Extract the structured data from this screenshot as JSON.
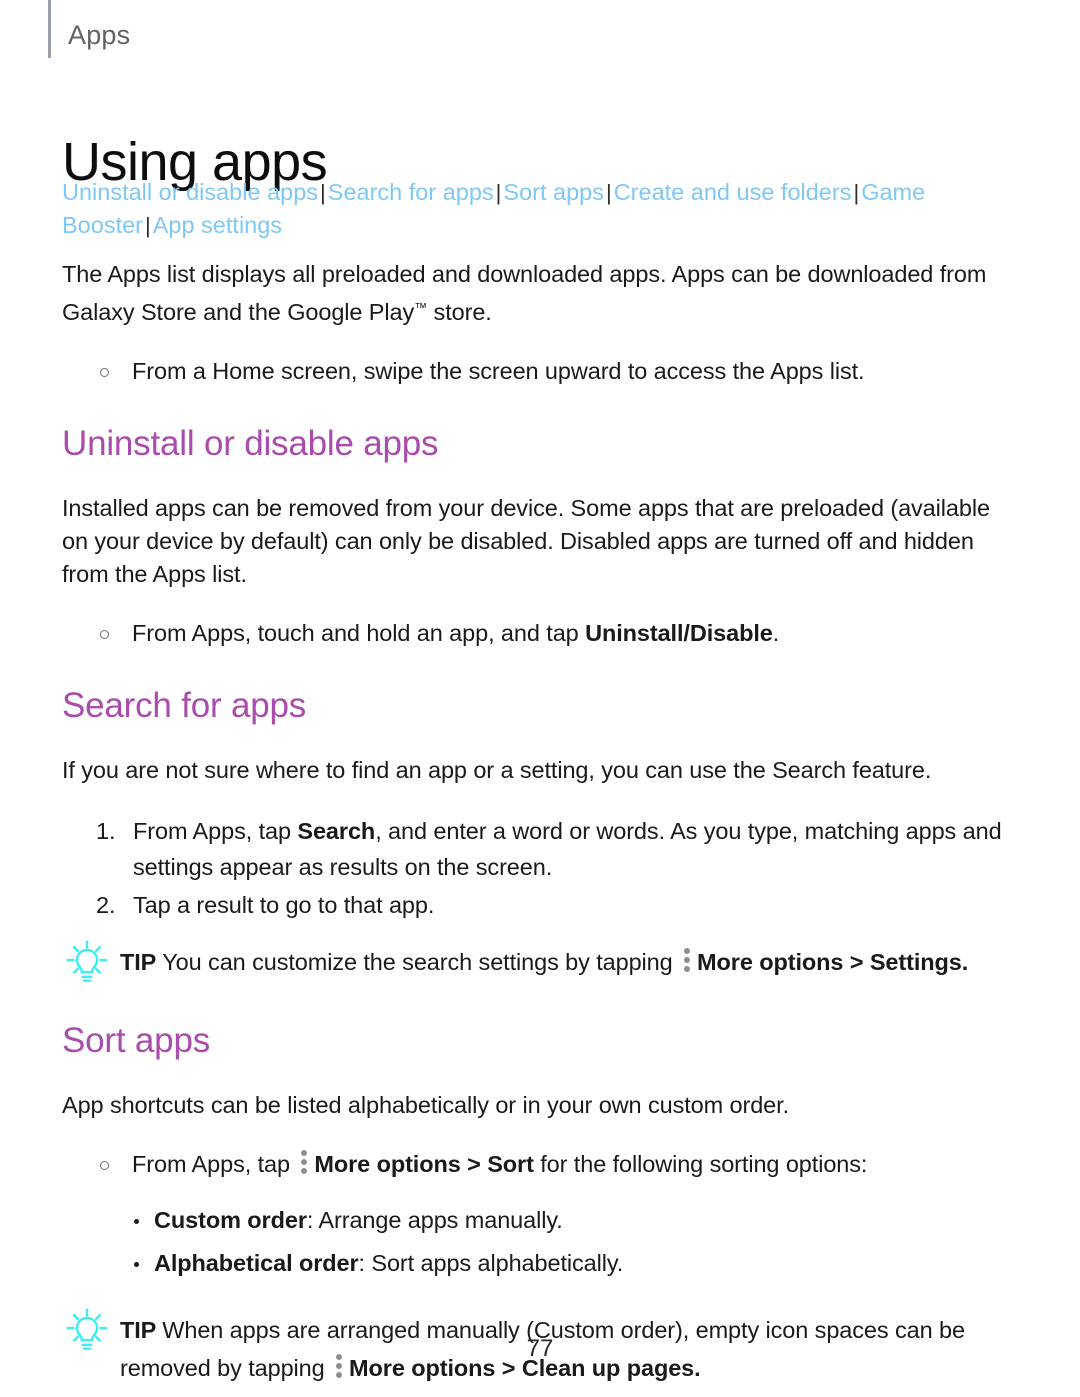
{
  "document": {
    "running_header": "Apps",
    "chapter_title": "Using apps",
    "page_number": "77"
  },
  "colors": {
    "link": "#7ec8f5",
    "section_heading": "#a94cab",
    "tip_icon": "#3deef0",
    "body_text": "#1a1a1a",
    "running_header_text": "#5f6368",
    "kebab_dots": "#8e8e8e"
  },
  "linkbar": {
    "separator": "|",
    "links": [
      {
        "label": "Uninstall or disable apps"
      },
      {
        "label": "Search for apps"
      },
      {
        "label": "Sort apps"
      },
      {
        "label": "Create and use folders"
      },
      {
        "label": "Game Booster"
      },
      {
        "label": "App settings"
      }
    ]
  },
  "intro": {
    "paragraph": "The Apps list displays all preloaded and downloaded apps. Apps can be downloaded from Galaxy Store and the Google Play",
    "trademark": "™",
    "paragraph_tail": " store.",
    "bullet": "From a Home screen, swipe the screen upward to access the Apps list."
  },
  "sections": [
    {
      "heading": "Uninstall or disable apps",
      "paragraph": "Installed apps can be removed from your device. Some apps that are preloaded (available on your device by default) can only be disabled. Disabled apps are turned off and hidden from the Apps list.",
      "bullet_prefix": "From Apps, touch and hold an app, and tap ",
      "bullet_bold": "Uninstall/Disable",
      "bullet_suffix": "."
    },
    {
      "heading": "Search for apps",
      "paragraph": "If you are not sure where to find an app or a setting, you can use the Search feature.",
      "steps": [
        {
          "prefix": "From Apps, tap ",
          "bold": "Search",
          "suffix": ", and enter a word or words. As you type, matching apps and settings appear as results on the screen."
        },
        {
          "prefix": "Tap a result to go to that app.",
          "bold": "",
          "suffix": ""
        }
      ],
      "tip": {
        "label": "TIP",
        "text_before_icon": "You can customize the search settings by tapping ",
        "icon_name": "more-options-icon",
        "bold_after_icon": "More options",
        "chevron": " > ",
        "bold_target": "Settings",
        "text_end": "."
      }
    },
    {
      "heading": "Sort apps",
      "paragraph": "App shortcuts can be listed alphabetically or in your own custom order.",
      "bullet_prefix": "From Apps, tap ",
      "bullet_bold": "More options",
      "bullet_chevron": " > ",
      "bullet_bold2": "Sort",
      "bullet_suffix": " for the following sorting options:",
      "options": [
        {
          "term": "Custom order",
          "desc": ": Arrange apps manually."
        },
        {
          "term": "Alphabetical order",
          "desc": ": Sort apps alphabetically."
        }
      ],
      "tip": {
        "label": "TIP",
        "text_before_icon": "When apps are arranged manually (Custom order), empty icon spaces can be removed by tapping ",
        "icon_name": "more-options-icon",
        "bold_after_icon": "More options",
        "chevron": " > ",
        "bold_target": "Clean up pages",
        "text_end": "."
      }
    }
  ]
}
